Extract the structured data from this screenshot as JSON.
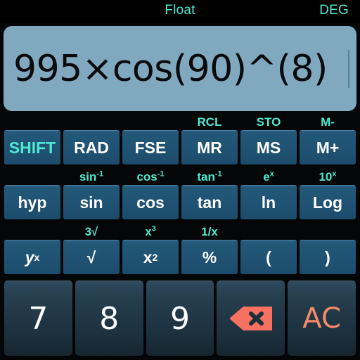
{
  "status": {
    "notation_mode": "Float",
    "angle_mode": "DEG"
  },
  "display": {
    "expression": "995×cos(90)^(8)",
    "cursor_visible": true,
    "background_color": "#80a9c0",
    "text_color": "#0a0a0a"
  },
  "colors": {
    "accent_cyan": "#4fe8cf",
    "accent_salmon": "#f58a68",
    "function_key": "#20536f",
    "number_key": "#22394a",
    "screen_bg": "#000000"
  },
  "keypad": {
    "rows": [
      {
        "shift_labels": [
          "",
          "",
          "",
          "RCL",
          "STO",
          "M-"
        ],
        "keys": [
          {
            "label": "SHIFT",
            "name": "shift",
            "accent": true
          },
          {
            "label": "RAD",
            "name": "rad"
          },
          {
            "label": "FSE",
            "name": "fse"
          },
          {
            "label": "MR",
            "name": "mr"
          },
          {
            "label": "MS",
            "name": "ms"
          },
          {
            "label": "M+",
            "name": "m-plus"
          }
        ]
      },
      {
        "shift_labels": [
          "",
          "sin-1",
          "cos-1",
          "tan-1",
          "e^x",
          "10^x"
        ],
        "keys": [
          {
            "label": "hyp",
            "name": "hyp"
          },
          {
            "label": "sin",
            "name": "sin"
          },
          {
            "label": "cos",
            "name": "cos"
          },
          {
            "label": "tan",
            "name": "tan"
          },
          {
            "label": "ln",
            "name": "ln"
          },
          {
            "label": "Log",
            "name": "log"
          }
        ]
      },
      {
        "shift_labels": [
          "",
          "3√",
          "x3",
          "1/x",
          "",
          ""
        ],
        "keys": [
          {
            "label": "y^x",
            "name": "y-to-x"
          },
          {
            "label": "√",
            "name": "square-root"
          },
          {
            "label": "x2",
            "name": "x-squared"
          },
          {
            "label": "%",
            "name": "percent"
          },
          {
            "label": "(",
            "name": "open-paren"
          },
          {
            "label": ")",
            "name": "close-paren"
          }
        ]
      }
    ],
    "shift_label_text": {
      "rcl": "RCL",
      "sto": "STO",
      "m_minus": "M-",
      "sin_inv_base": "sin",
      "sin_inv_sup": "-1",
      "cos_inv_base": "cos",
      "cos_inv_sup": "-1",
      "tan_inv_base": "tan",
      "tan_inv_sup": "-1",
      "e_base": "e",
      "e_sup": "x",
      "ten_base": "10",
      "ten_sup": "x",
      "cbrt": "3√",
      "x_cube_base": "x",
      "x_cube_sup": "3",
      "reciprocal": "1/x"
    },
    "key_labels": {
      "shift": "SHIFT",
      "rad": "RAD",
      "fse": "FSE",
      "mr": "MR",
      "ms": "MS",
      "m_plus": "M+",
      "hyp": "hyp",
      "sin": "sin",
      "cos": "cos",
      "tan": "tan",
      "ln": "ln",
      "log": "Log",
      "y_base": "y",
      "y_sup": "x",
      "sqrt": "√",
      "x_sq_base": "x",
      "x_sq_sup": "2",
      "percent": "%",
      "open_paren": "(",
      "close_paren": ")",
      "seven": "7",
      "eight": "8",
      "nine": "9",
      "backspace": "backspace-icon",
      "all_clear": "AC"
    }
  }
}
